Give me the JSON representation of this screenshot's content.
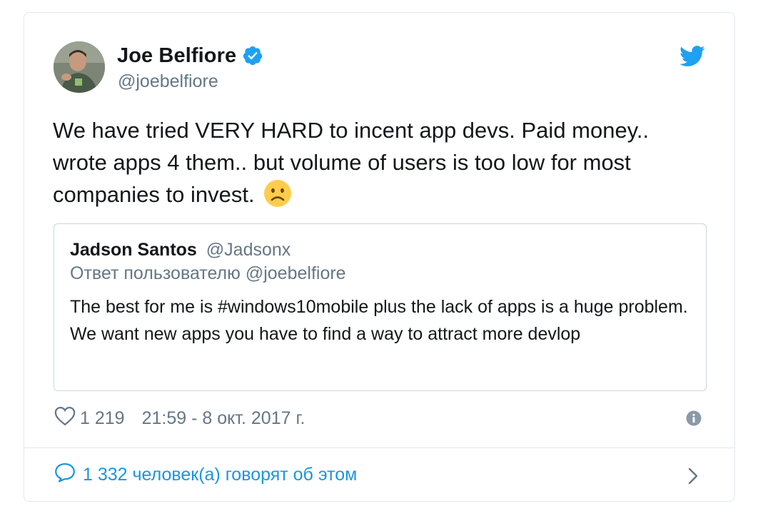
{
  "tweet": {
    "author_name": "Joe Belfiore",
    "author_handle": "@joebelfiore",
    "verified_icon": "verified-badge-icon",
    "brand_icon": "twitter-bird-icon",
    "text": "We have tried VERY HARD to incent app devs. Paid money.. wrote apps 4 them.. but volume of users is too low for most companies to invest.",
    "emoji_icon": "sad-face-emoji",
    "likes": "1 219",
    "timestamp": "21:59 - 8 окт. 2017 г.",
    "conversation_label": "1 332 человек(а) говорят об этом"
  },
  "quoted": {
    "author_name": "Jadson Santos",
    "author_handle": "@Jadsonx",
    "reply_to": "Ответ пользователю @joebelfiore",
    "text": "The best for me is #windows10mobile  plus the lack of apps is a huge problem. We want new apps you have to find a way to attract more devlop"
  },
  "colors": {
    "link_blue": "#1b95e0",
    "secondary_gray": "#657786",
    "text_dark": "#14171a",
    "border": "#e1e8ed"
  }
}
